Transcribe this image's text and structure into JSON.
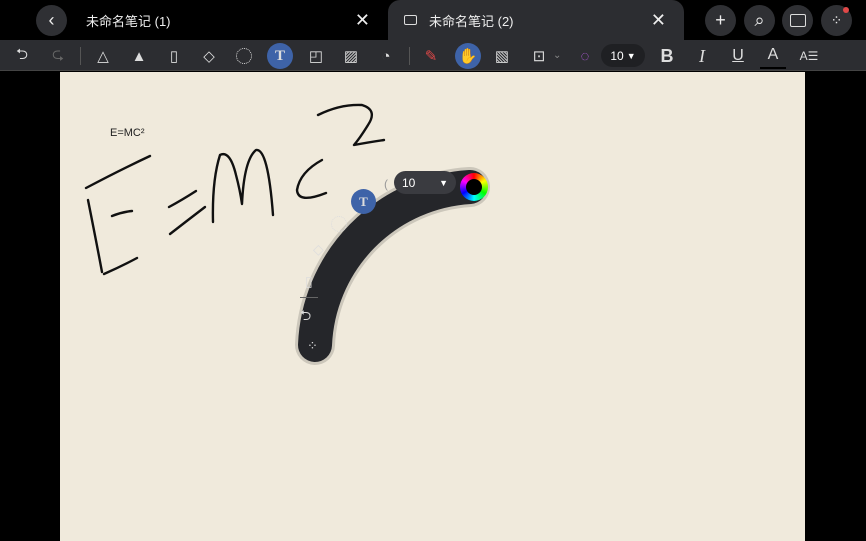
{
  "tabs": [
    {
      "title": "未命名笔记 (1)",
      "active": false
    },
    {
      "title": "未命名笔记 (2)",
      "active": true
    }
  ],
  "toolbar": {
    "font_size": "10",
    "bold": "B",
    "italic": "I",
    "underline": "U",
    "text_color": "A",
    "paragraph": "A☰"
  },
  "canvas": {
    "typed_text": "E=MC²",
    "handwriting": "E=MC²"
  },
  "arc_toolbar": {
    "size": "10"
  },
  "colors": {
    "accent": "#3e63a8",
    "paper": "#f0eadc",
    "toolbar": "#2c2d31",
    "notification": "#e04848"
  }
}
